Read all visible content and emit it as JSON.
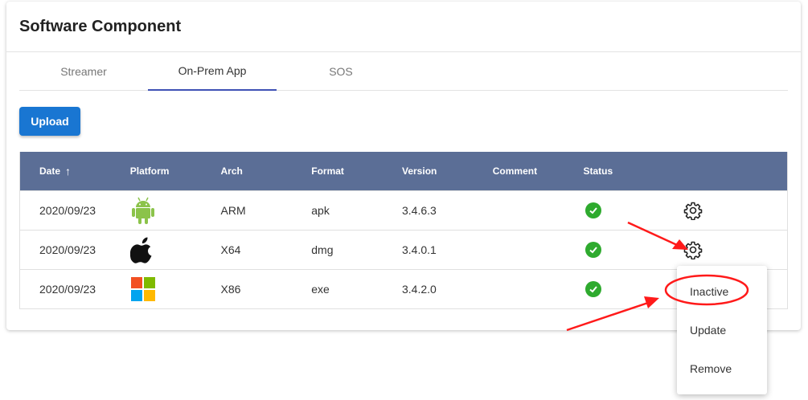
{
  "card": {
    "title": "Software Component"
  },
  "tabs": [
    {
      "label": "Streamer",
      "active": false
    },
    {
      "label": "On-Prem App",
      "active": true
    },
    {
      "label": "SOS",
      "active": false
    }
  ],
  "toolbar": {
    "upload_label": "Upload"
  },
  "table": {
    "headers": {
      "date": "Date",
      "platform": "Platform",
      "arch": "Arch",
      "format": "Format",
      "version": "Version",
      "comment": "Comment",
      "status": "Status"
    },
    "sort_icon": "arrow-up-icon",
    "rows": [
      {
        "date": "2020/09/23",
        "platform_icon": "android-icon",
        "arch": "ARM",
        "format": "apk",
        "version": "3.4.6.3",
        "comment": "",
        "status_icon": "check-circle-icon"
      },
      {
        "date": "2020/09/23",
        "platform_icon": "apple-icon",
        "arch": "X64",
        "format": "dmg",
        "version": "3.4.0.1",
        "comment": "",
        "status_icon": "check-circle-icon"
      },
      {
        "date": "2020/09/23",
        "platform_icon": "windows-icon",
        "arch": "X86",
        "format": "exe",
        "version": "3.4.2.0",
        "comment": "",
        "status_icon": "check-circle-icon"
      }
    ]
  },
  "menu": {
    "items": [
      {
        "label": "Inactive"
      },
      {
        "label": "Update"
      },
      {
        "label": "Remove"
      }
    ]
  },
  "colors": {
    "header_bg": "#5b6e96",
    "accent": "#1976d2",
    "tab_indicator": "#3f51b5",
    "status_ok": "#2eaa2e",
    "annotation": "#ff1a1a",
    "android": "#8bc34a"
  }
}
